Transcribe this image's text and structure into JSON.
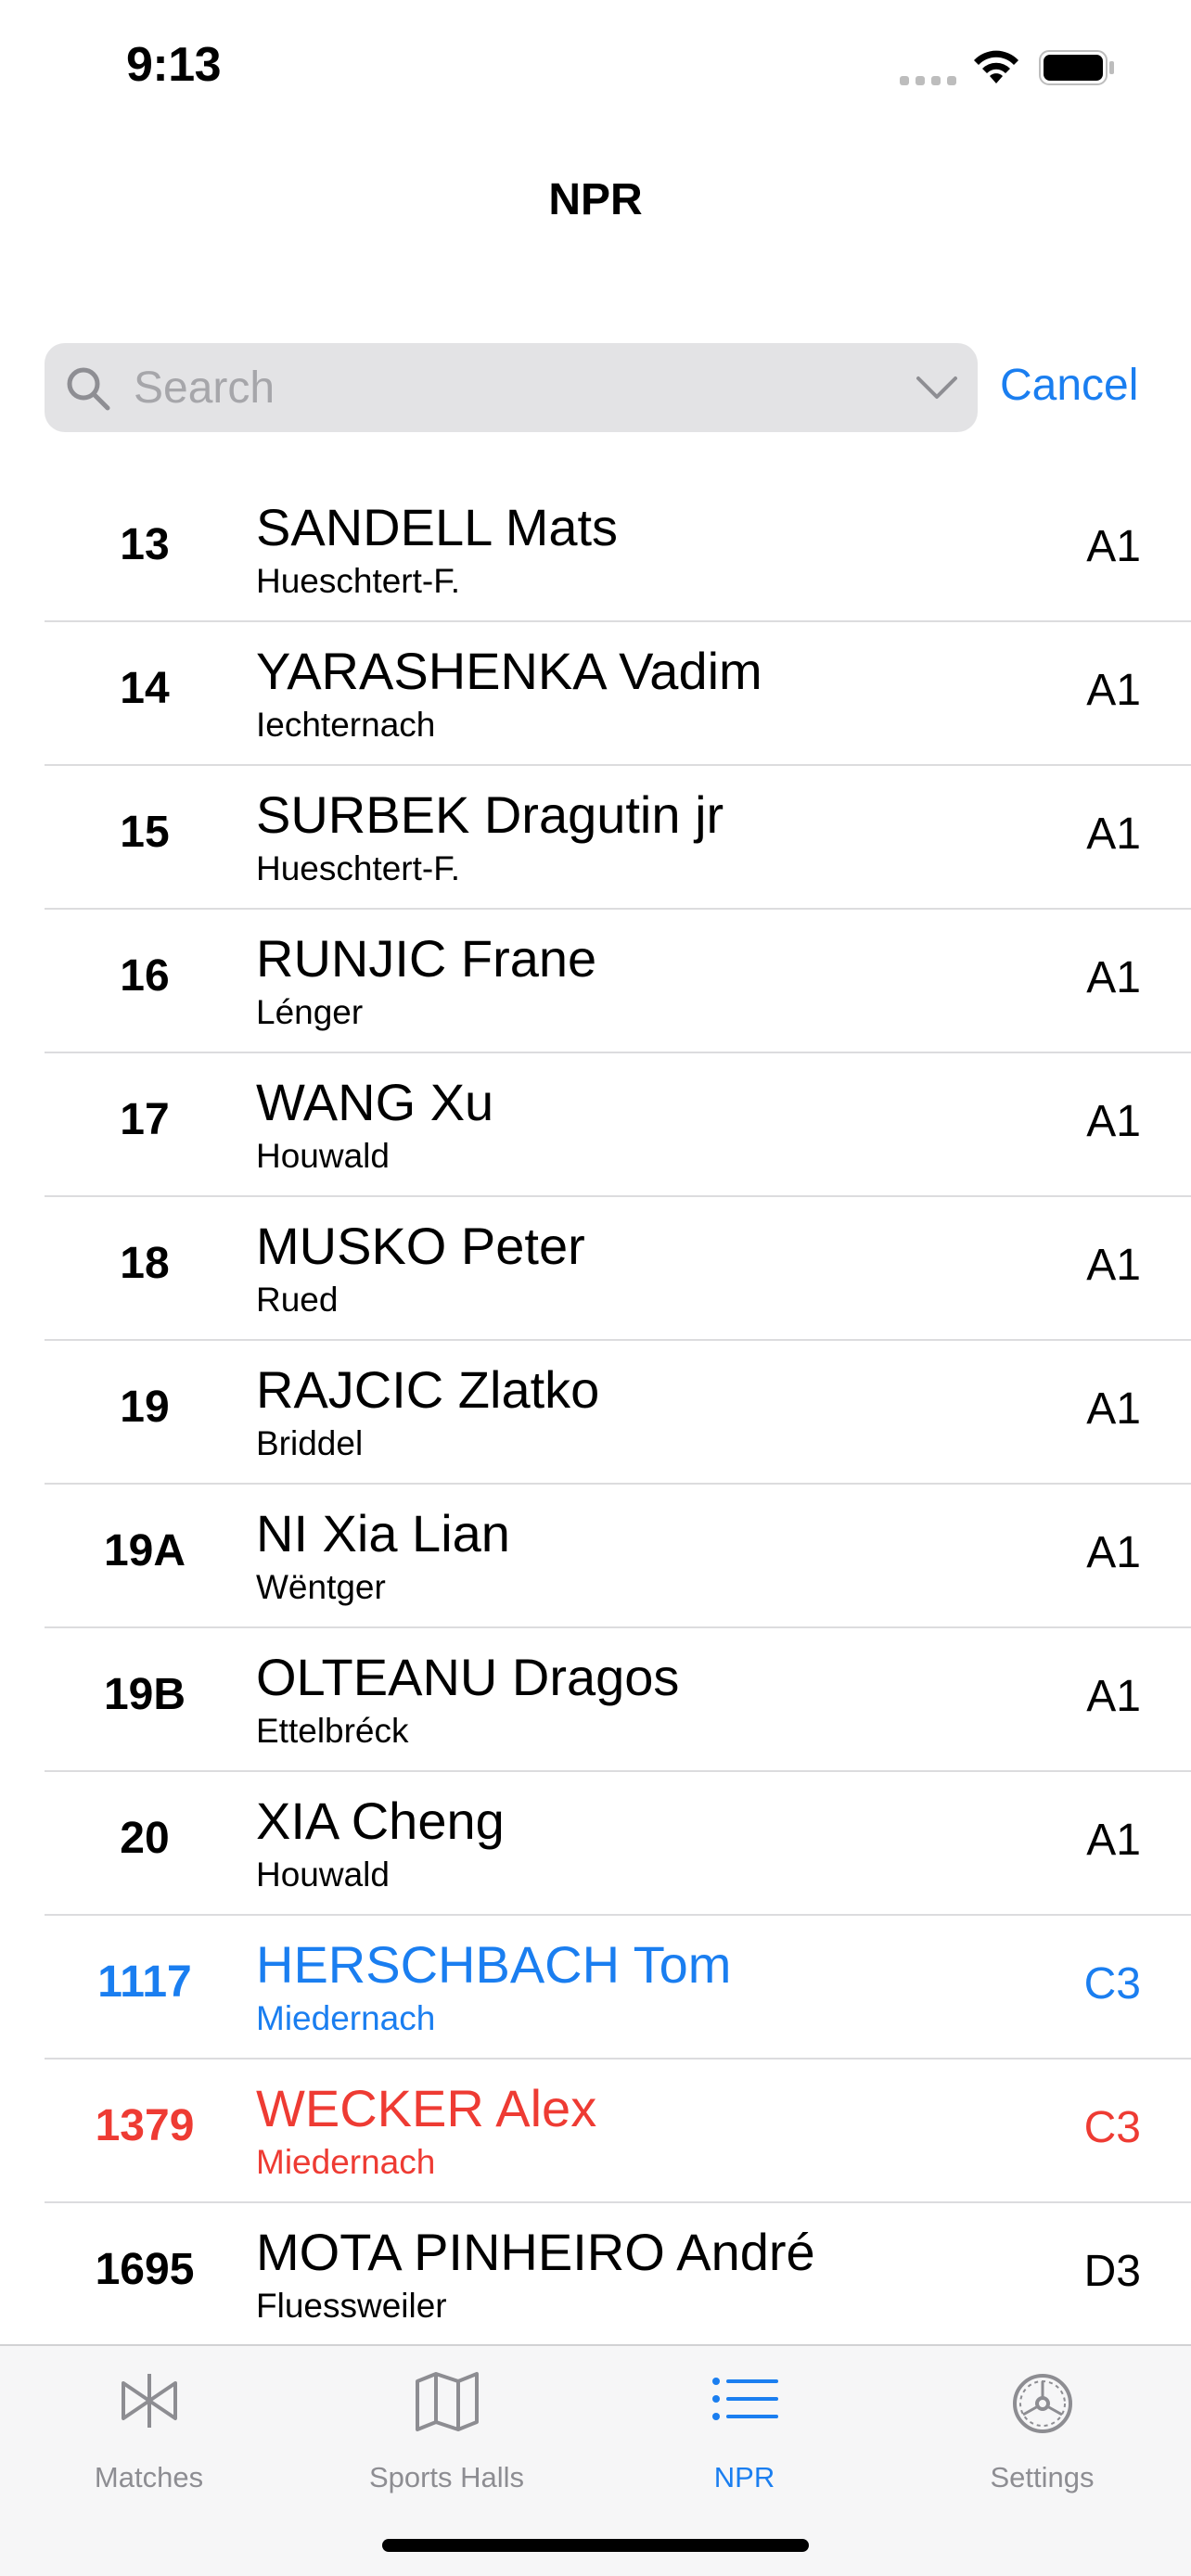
{
  "status_bar": {
    "time": "9:13"
  },
  "nav": {
    "title": "NPR"
  },
  "search": {
    "placeholder": "Search",
    "cancel_label": "Cancel"
  },
  "rows": [
    {
      "rank": "13",
      "name": "SANDELL Mats",
      "club": "Hueschtert-F.",
      "class": "A1",
      "style": "normal"
    },
    {
      "rank": "14",
      "name": "YARASHENKA Vadim",
      "club": "Iechternach",
      "class": "A1",
      "style": "normal"
    },
    {
      "rank": "15",
      "name": "SURBEK Dragutin jr",
      "club": "Hueschtert-F.",
      "class": "A1",
      "style": "normal"
    },
    {
      "rank": "16",
      "name": "RUNJIC Frane",
      "club": "Lénger",
      "class": "A1",
      "style": "normal"
    },
    {
      "rank": "17",
      "name": "WANG Xu",
      "club": "Houwald",
      "class": "A1",
      "style": "normal"
    },
    {
      "rank": "18",
      "name": "MUSKO Peter",
      "club": "Rued",
      "class": "A1",
      "style": "normal"
    },
    {
      "rank": "19",
      "name": "RAJCIC Zlatko",
      "club": "Briddel",
      "class": "A1",
      "style": "normal"
    },
    {
      "rank": "19A",
      "name": "NI Xia Lian",
      "club": "Wëntger",
      "class": "A1",
      "style": "normal"
    },
    {
      "rank": "19B",
      "name": "OLTEANU Dragos",
      "club": "Ettelbréck",
      "class": "A1",
      "style": "normal"
    },
    {
      "rank": "20",
      "name": "XIA Cheng",
      "club": "Houwald",
      "class": "A1",
      "style": "normal"
    },
    {
      "rank": "1117",
      "name": "HERSCHBACH Tom",
      "club": "Miedernach",
      "class": "C3",
      "style": "blue"
    },
    {
      "rank": "1379",
      "name": "WECKER Alex",
      "club": "Miedernach",
      "class": "C3",
      "style": "red"
    },
    {
      "rank": "1695",
      "name": "MOTA PINHEIRO André",
      "club": "Fluessweiler",
      "class": "D3",
      "style": "normal"
    }
  ],
  "tabs": [
    {
      "label": "Matches",
      "icon": "matches-icon",
      "active": false
    },
    {
      "label": "Sports Halls",
      "icon": "map-icon",
      "active": false
    },
    {
      "label": "NPR",
      "icon": "list-icon",
      "active": true
    },
    {
      "label": "Settings",
      "icon": "gear-icon",
      "active": false
    }
  ],
  "colors": {
    "accent": "#1a7ef0",
    "highlight_red": "#ee3b33",
    "inactive": "#8d8d92"
  }
}
